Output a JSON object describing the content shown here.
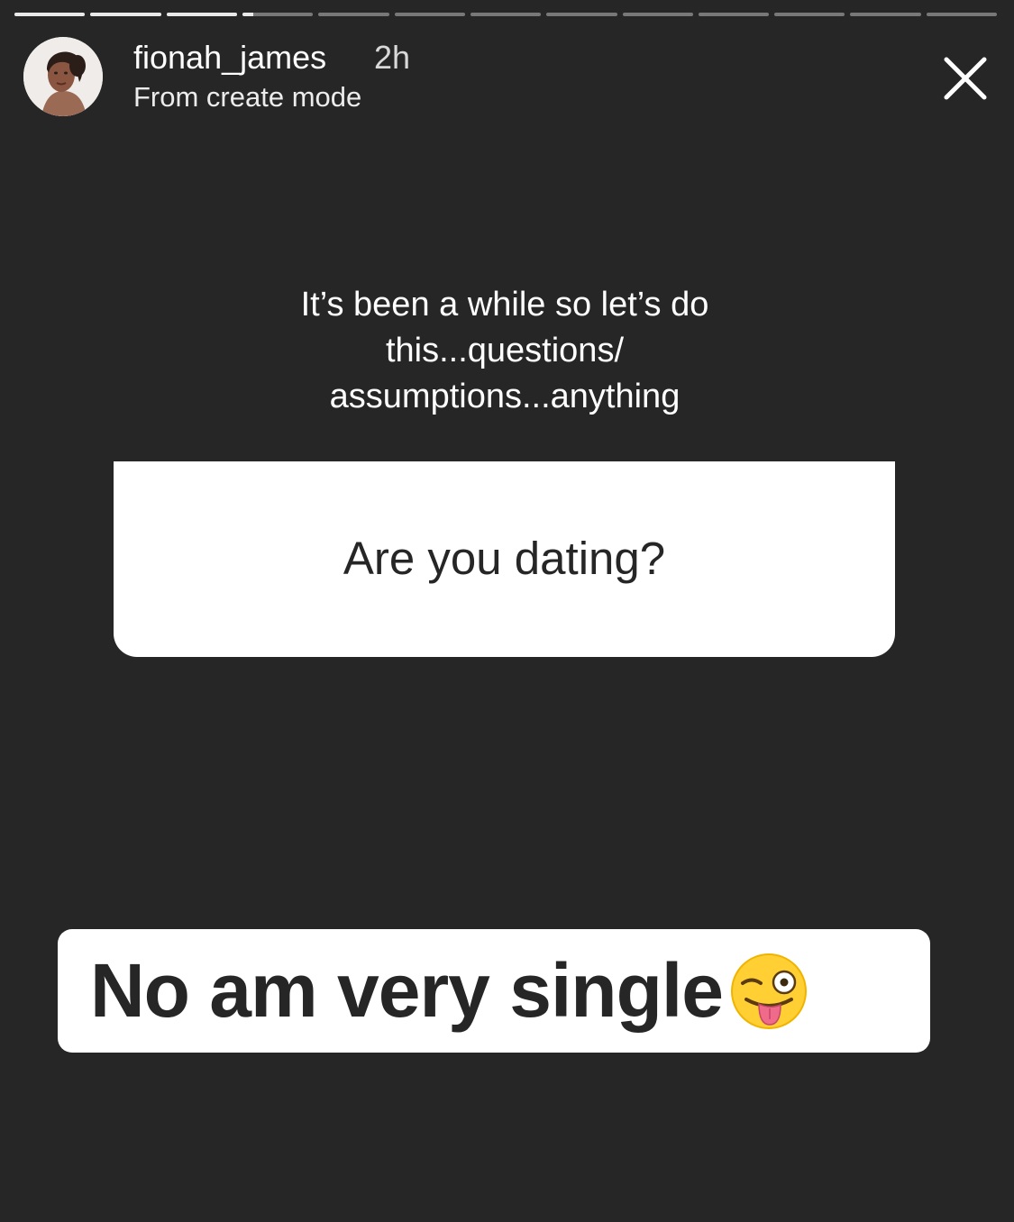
{
  "story": {
    "segment_count": 13,
    "completed_segments": 3,
    "current_segment_progress": 0.15
  },
  "header": {
    "username": "fionah_james",
    "time_ago": "2h",
    "subtitle": "From create mode",
    "avatar_icon": "profile-photo",
    "close_icon": "close-icon"
  },
  "prompt": {
    "lines": [
      "It’s been a while so let’s do",
      "this...questions/",
      "assumptions...anything"
    ]
  },
  "question_card": {
    "text": "Are you dating?"
  },
  "answer": {
    "text": "No am very single",
    "emoji": "winking-face-with-tongue"
  },
  "colors": {
    "background": "#262626",
    "card": "#ffffff",
    "text_dark": "#262626"
  }
}
